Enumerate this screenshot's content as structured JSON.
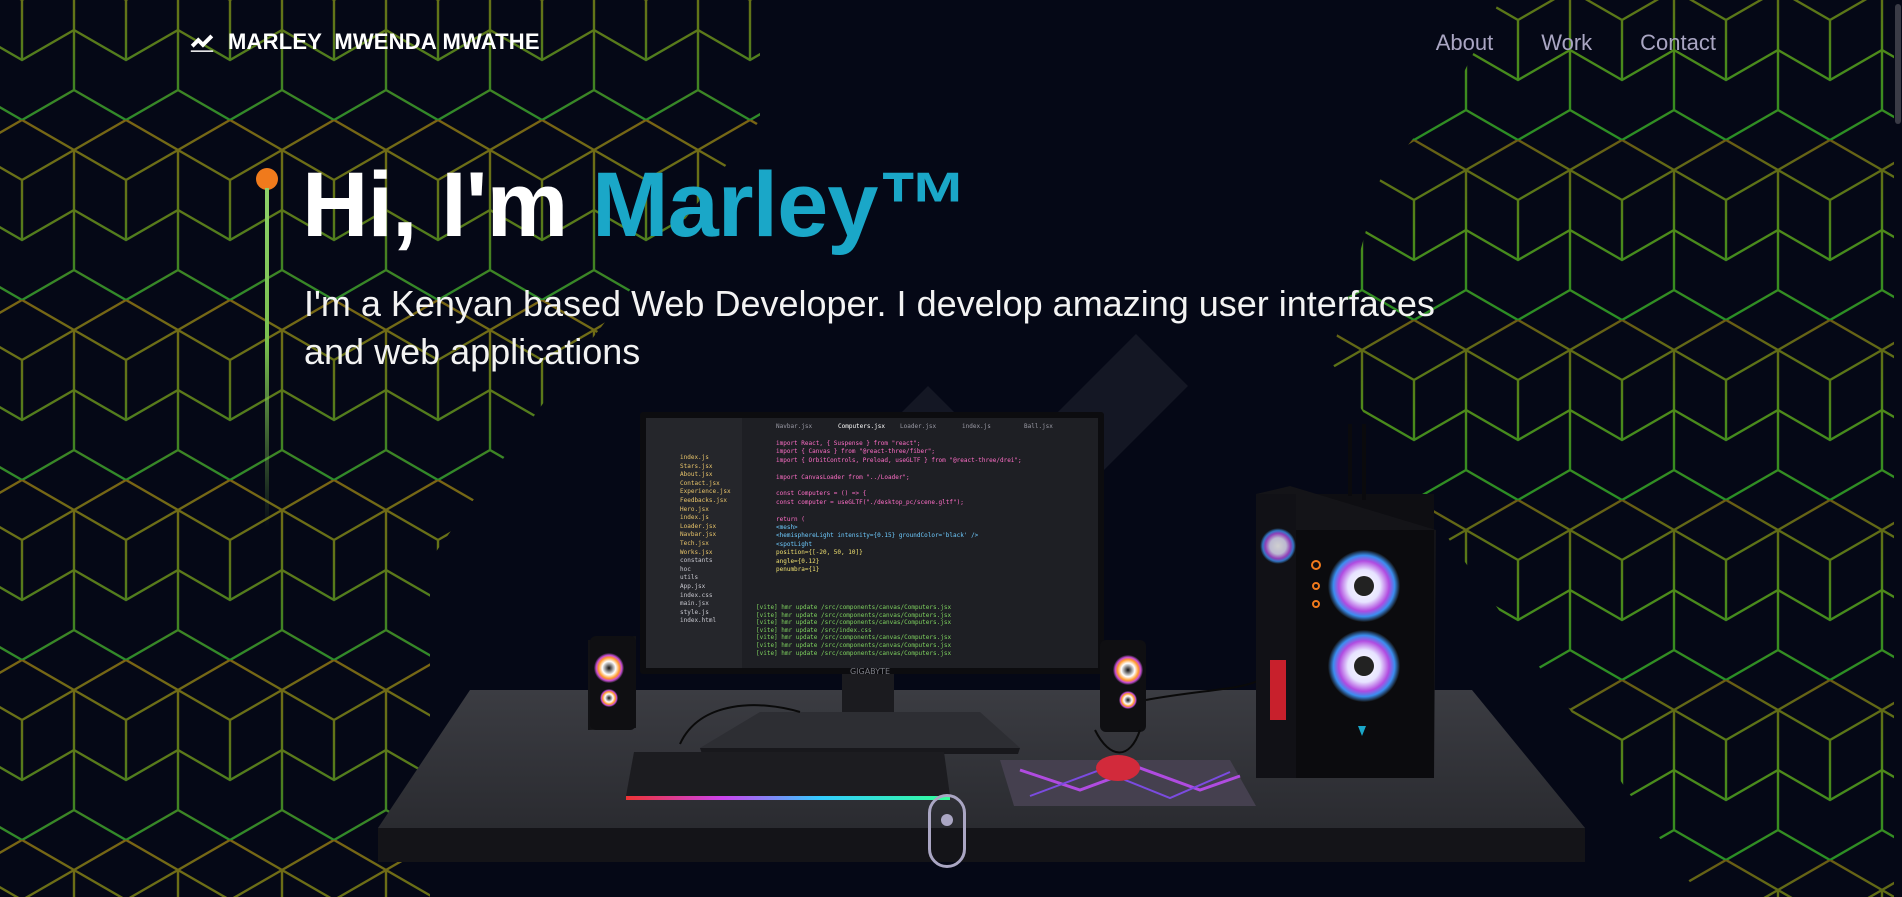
{
  "nav": {
    "brand_name": "MARLEY  MWENDA MWATHE",
    "links": [
      "About",
      "Work",
      "Contact"
    ]
  },
  "hero": {
    "greeting": "Hi, I'm",
    "name": "Marley™",
    "subtitle": "I'm a Kenyan based Web Developer. I develop amazing user interfaces and web applications"
  },
  "scene": {
    "monitor_brand": "GIGABYTE",
    "editor_tabs": [
      "Navbar.jsx",
      "Computers.jsx",
      "Loader.jsx",
      "index.js",
      "Ball.jsx"
    ],
    "code_lines": [
      "import React, { Suspense } from \"react\";",
      "import { Canvas } from \"@react-three/fiber\";",
      "import { OrbitControls, Preload, useGLTF } from \"@react-three/drei\";",
      "",
      "import CanvasLoader from \"../Loader\";",
      "",
      "const Computers = () => {",
      "  const computer = useGLTF(\"./desktop_pc/scene.gltf\");",
      "",
      "  return (",
      "    <mesh>",
      "      <hemisphereLight intensity={0.15} groundColor='black' />",
      "      <spotLight",
      "        position={[-20, 50, 10]}",
      "        angle={0.12}",
      "        penumbra={1}"
    ],
    "terminal_lines": [
      "[vite] hmr update /src/components/canvas/Computers.jsx",
      "[vite] hmr update /src/components/canvas/Computers.jsx",
      "[vite] hmr update /src/components/canvas/Computers.jsx",
      "[vite] hmr update /src/index.css",
      "[vite] hmr update /src/components/canvas/Computers.jsx",
      "[vite] hmr update /src/components/canvas/Computers.jsx",
      "[vite] hmr update /src/components/canvas/Computers.jsx"
    ],
    "file_tree": [
      "index.js",
      "Stars.jsx",
      "About.jsx",
      "Contact.jsx",
      "Experience.jsx",
      "Feedbacks.jsx",
      "Hero.jsx",
      "index.js",
      "Loader.jsx",
      "Navbar.jsx",
      "Tech.jsx",
      "Works.jsx",
      "constants",
      "hoc",
      "utils",
      "App.jsx",
      "index.css",
      "main.jsx",
      "style.js",
      "index.html"
    ]
  },
  "colors": {
    "background": "#050816",
    "accent": "#1aa7c8",
    "dot": "#f07a1c",
    "nav_text": "#aaa6c3"
  },
  "icons": {
    "brand": "brand-logo-icon",
    "scroll": "mouse-scroll-icon"
  }
}
